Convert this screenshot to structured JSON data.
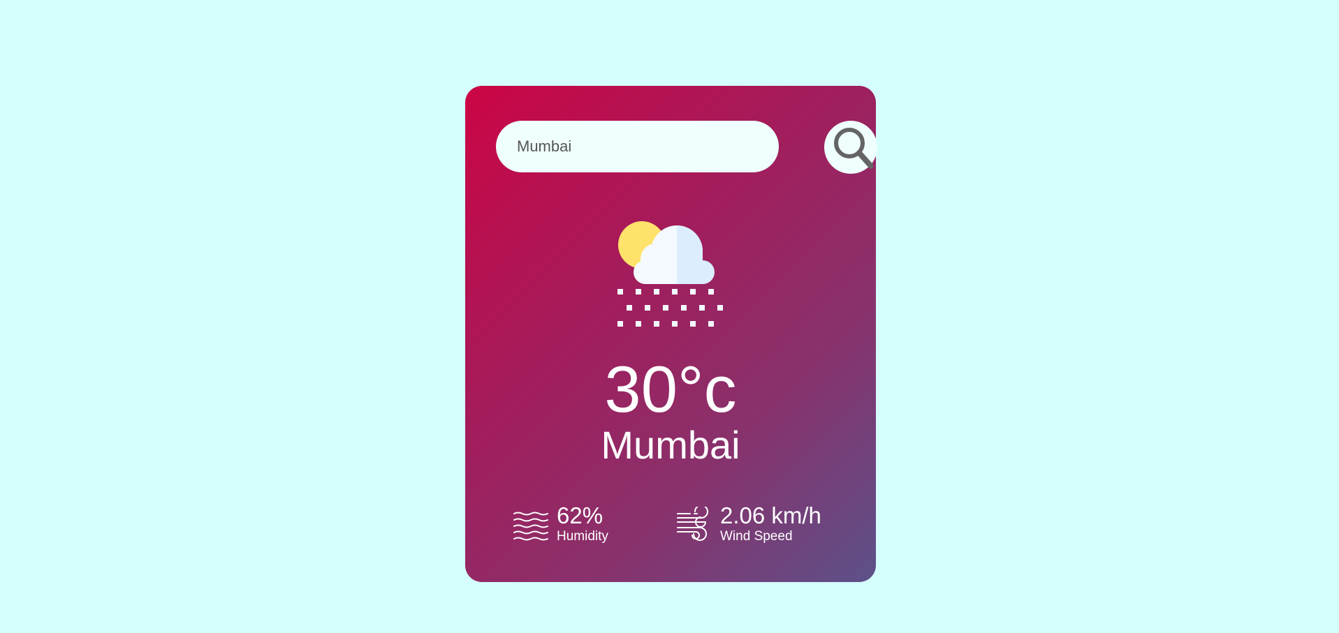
{
  "search": {
    "value": "Mumbai",
    "placeholder": "Enter city name"
  },
  "weather": {
    "icon": "sun-cloud-snow-icon",
    "temperature": "30°c",
    "city": "Mumbai"
  },
  "details": {
    "humidity": {
      "value": "62%",
      "label": "Humidity",
      "icon": "humidity-waves-icon"
    },
    "wind": {
      "value": "2.06 km/h",
      "label": "Wind Speed",
      "icon": "wind-icon"
    }
  },
  "colors": {
    "page_background": "#d5fffd",
    "card_gradient_start": "#cc0545",
    "card_gradient_end": "#5c5189",
    "input_background": "#effffd",
    "text": "#ffffff"
  }
}
